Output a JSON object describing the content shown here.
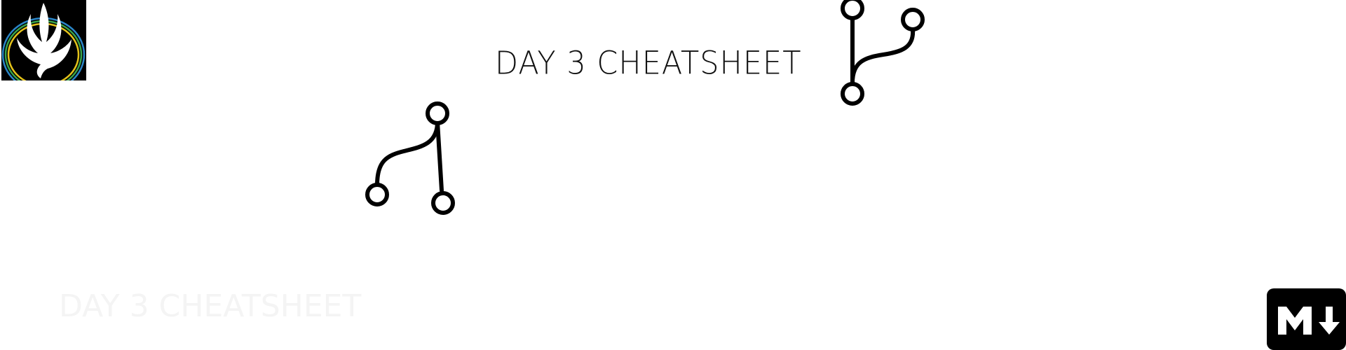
{
  "header": {
    "title": "DAY 3 CHEATSHEET"
  },
  "footer": {
    "faint_caption": "DAY 3 CHEATSHEET"
  },
  "icons": {
    "logo": "phoenix-logo-icon",
    "branch_top": "git-branch-icon",
    "branch_left": "git-merge-icon",
    "markdown": "markdown-icon"
  },
  "colors": {
    "background": "#ffffff",
    "foreground": "#000000",
    "logo_ring_blue": "#2a86c8",
    "logo_ring_green": "#39a44a",
    "logo_ring_yellow": "#e3c21a"
  }
}
